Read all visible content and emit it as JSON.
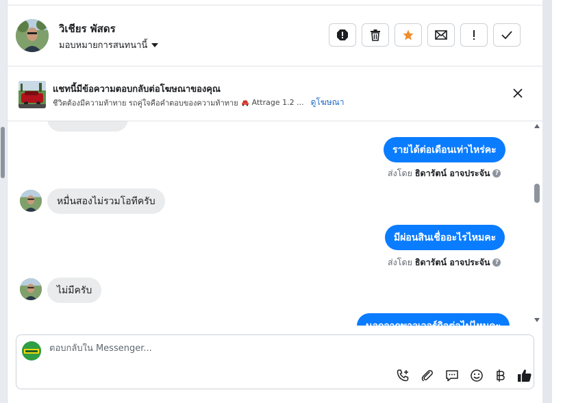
{
  "header": {
    "contact_name": "วิเชียร พัสดร",
    "assign_label": "มอบหมายการสนทนานี้",
    "toolbar": [
      {
        "name": "spam-icon"
      },
      {
        "name": "trash-icon"
      },
      {
        "name": "star-icon"
      },
      {
        "name": "mark-unread-icon"
      },
      {
        "name": "follow-up-icon"
      },
      {
        "name": "mark-done-icon"
      }
    ]
  },
  "ad": {
    "title": "แชทนี้มีข้อความตอบกลับต่อโฆษณาของคุณ",
    "subtitle": "ชีวิตต้องมีความท้าทาย รถคู่ใจคือคำตอบของความท้าทาย",
    "car_text": "Attrage 1.2 ...",
    "link": "ดูโฆษณา"
  },
  "messages": [
    {
      "direction": "out",
      "text": "รายได้ต่อเดือนเท่าไหร่คะ",
      "sent_by_label": "ส่งโดย",
      "sender": "ธิดารัตน์ อาจประจัน"
    },
    {
      "direction": "in",
      "text": "หมื่นสองไม่รวมโอทีครับ"
    },
    {
      "direction": "out",
      "text": "มีผ่อนสินเชื่ออะไรไหมคะ",
      "sent_by_label": "ส่งโดย",
      "sender": "ธิดารัตน์ อาจประจัน"
    },
    {
      "direction": "in",
      "text": "ไม่มีครับ"
    },
    {
      "direction": "out",
      "text": "นอกจากพาวเวอร์กิจต่อไปไหมคะ"
    }
  ],
  "composer": {
    "placeholder": "ตอบกลับใน Messenger...",
    "icons": [
      "call-icon",
      "attachment-icon",
      "saved-reply-icon",
      "emoji-icon",
      "payment-icon",
      "like-icon"
    ]
  },
  "colors": {
    "accent": "#0a7cff",
    "star": "#f08c2c",
    "link": "#1a66c8"
  }
}
